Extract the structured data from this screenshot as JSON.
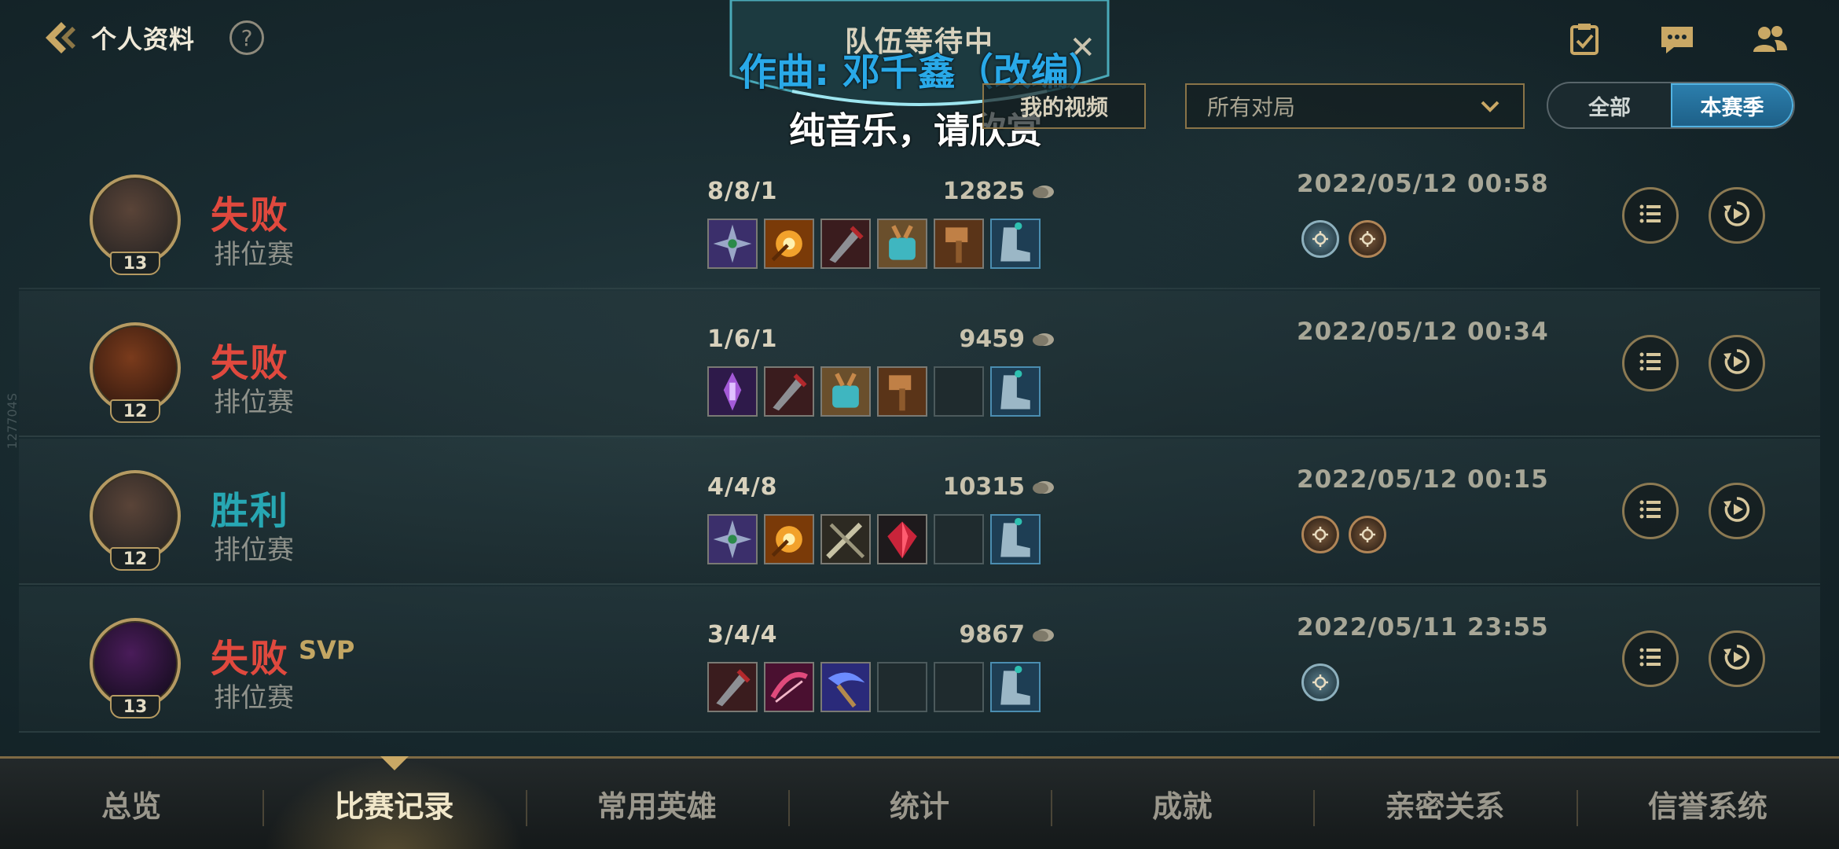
{
  "header": {
    "back_label": "个人资料",
    "help_label": "?",
    "icons": [
      "task-icon",
      "chat-icon",
      "friends-icon"
    ]
  },
  "team_banner": {
    "title": "队伍等待中",
    "close": "✕"
  },
  "overlay": {
    "lyric_line1": "作曲: 邓千鑫（改编）",
    "lyric_line2": "纯音乐，请欣赏"
  },
  "filters": {
    "my_video": "我的视频",
    "match_filter": "所有对局",
    "season_all": "全部",
    "season_current": "本赛季"
  },
  "matches": [
    {
      "result": "失败",
      "result_type": "lose",
      "svp": "",
      "mode": "排位赛",
      "level": "13",
      "kda": "8/8/1",
      "gold": "12825",
      "date": "2022/05/12 00:58",
      "items": [
        "shuriken",
        "sun-orb",
        "blade",
        "crystal-gauntlet",
        "hammer",
        "boots"
      ],
      "medals": [
        "blue",
        "bronze"
      ]
    },
    {
      "result": "失败",
      "result_type": "lose",
      "svp": "",
      "mode": "排位赛",
      "level": "12",
      "kda": "1/6/1",
      "gold": "9459",
      "date": "2022/05/12 00:34",
      "items": [
        "purple-relic",
        "blade",
        "crystal-gauntlet",
        "hammer",
        "",
        "boots"
      ],
      "medals": []
    },
    {
      "result": "胜利",
      "result_type": "win",
      "svp": "",
      "mode": "排位赛",
      "level": "12",
      "kda": "4/4/8",
      "gold": "10315",
      "date": "2022/05/12 00:15",
      "items": [
        "shuriken",
        "sun-orb",
        "swords",
        "ruby",
        "",
        "boots"
      ],
      "medals": [
        "bronze",
        "bronze"
      ]
    },
    {
      "result": "失败",
      "result_type": "lose",
      "svp": "SVP",
      "mode": "排位赛",
      "level": "13",
      "kda": "3/4/4",
      "gold": "9867",
      "date": "2022/05/11 23:55",
      "items": [
        "blade",
        "crimson-bow",
        "scythe",
        "",
        "",
        "boots"
      ],
      "medals": [
        "blue"
      ]
    }
  ],
  "side_mark": "127704S",
  "bottom_nav": {
    "tabs": [
      "总览",
      "比赛记录",
      "常用英雄",
      "统计",
      "成就",
      "亲密关系",
      "信誉系统"
    ],
    "active_index": 1
  },
  "colors": {
    "lose": "#e0493e",
    "win": "#27a7b3",
    "gold_border": "#b59a62",
    "accent_blue": "#2c7fae"
  }
}
